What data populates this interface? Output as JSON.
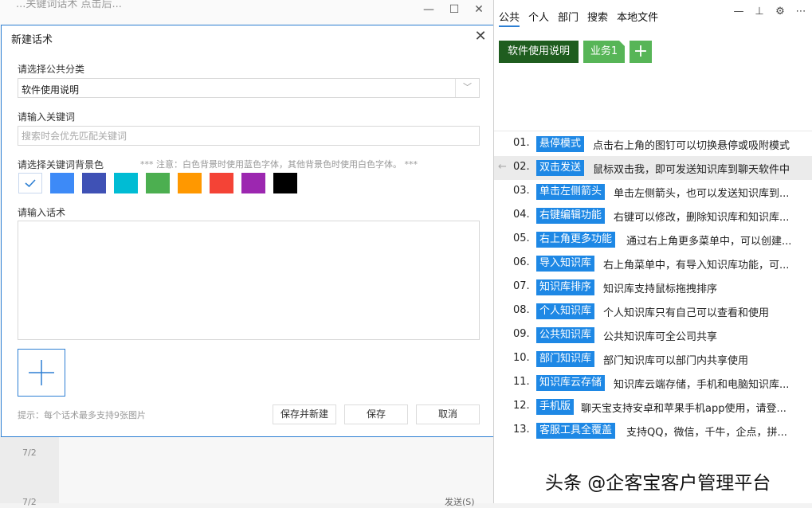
{
  "background": {
    "title": "...关键词话术 点击后...",
    "items": [
      "7/2",
      "7/2"
    ],
    "send_label": "发送(S)"
  },
  "dialog": {
    "title": "新建话术",
    "category_label": "请选择公共分类",
    "category_value": "软件使用说明",
    "keyword_label": "请输入关键词",
    "keyword_placeholder": "搜索时会优先匹配关键词",
    "color_label": "请选择关键词背景色",
    "color_note": "*** 注意：白色背景时使用蓝色字体，其他背景色时使用白色字体。 ***",
    "colors": [
      "#ffffff",
      "#3d8af7",
      "#3f51b5",
      "#00bcd4",
      "#4caf50",
      "#ff9800",
      "#f44336",
      "#9c27b0",
      "#000000"
    ],
    "script_label": "请输入话术",
    "hint": "提示：每个话术最多支持9张图片",
    "buttons": {
      "save_new": "保存并新建",
      "save": "保存",
      "cancel": "取消"
    }
  },
  "panel": {
    "tabs": [
      "公共",
      "个人",
      "部门",
      "搜索",
      "本地文件"
    ],
    "categories": {
      "active": "软件使用说明",
      "second": "业务1",
      "add": "+"
    },
    "items": [
      {
        "num": "01.",
        "keyword": "悬停模式",
        "text": "点击右上角的图钉可以切换悬停或吸附模式"
      },
      {
        "num": "02.",
        "keyword": "双击发送",
        "text": "鼠标双击我，即可发送知识库到聊天软件中"
      },
      {
        "num": "03.",
        "keyword": "单击左侧箭头",
        "text": "单击左侧箭头，也可以发送知识库到..."
      },
      {
        "num": "04.",
        "keyword": "右键编辑功能",
        "text": "右键可以修改，删除知识库和知识库..."
      },
      {
        "num": "05.",
        "keyword": "右上角更多功能",
        "text": "通过右上角更多菜单中，可以创建..."
      },
      {
        "num": "06.",
        "keyword": "导入知识库",
        "text": "右上角菜单中，有导入知识库功能，可..."
      },
      {
        "num": "07.",
        "keyword": "知识库排序",
        "text": "知识库支持鼠标拖拽排序"
      },
      {
        "num": "08.",
        "keyword": "个人知识库",
        "text": "个人知识库只有自己可以查看和使用"
      },
      {
        "num": "09.",
        "keyword": "公共知识库",
        "text": "公共知识库可全公司共享"
      },
      {
        "num": "10.",
        "keyword": "部门知识库",
        "text": "部门知识库可以部门内共享使用"
      },
      {
        "num": "11.",
        "keyword": "知识库云存储",
        "text": "知识库云端存储，手机和电脑知识库..."
      },
      {
        "num": "12.",
        "keyword": "手机版",
        "text": "聊天宝支持安卓和苹果手机app使用，请登..."
      },
      {
        "num": "13.",
        "keyword": "客服工具全覆盖",
        "text": "支持QQ，微信，千牛，企点，拼..."
      }
    ]
  },
  "watermark": "头条 @企客宝客户管理平台"
}
